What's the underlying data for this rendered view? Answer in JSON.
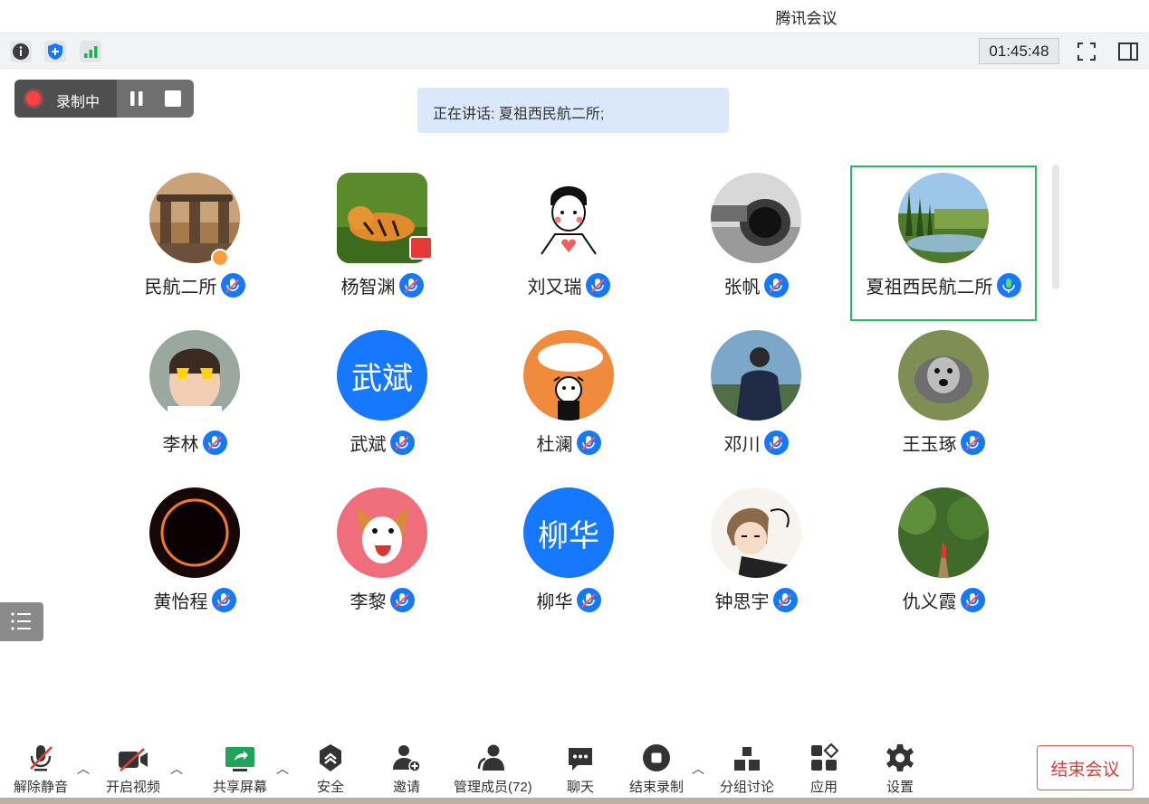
{
  "app": {
    "title": "腾讯会议"
  },
  "top_bar": {
    "timer": "01:45:48"
  },
  "recording": {
    "label": "录制中"
  },
  "speaking": {
    "text": "正在讲话: 夏祖西民航二所;"
  },
  "participants": [
    {
      "name": "民航二所",
      "avatar": "city-skyline-photo"
    },
    {
      "name": "杨智渊",
      "avatar": "tiger-photo"
    },
    {
      "name": "刘又瑞",
      "avatar": "cartoon-boy-illustration"
    },
    {
      "name": "张帆",
      "avatar": "jet-engine-photo"
    },
    {
      "name": "夏祖西民航二所",
      "avatar": "lake-trees-photo"
    },
    {
      "name": "李林",
      "avatar": "child-sunglasses-photo"
    },
    {
      "name": "武斌",
      "avatar_text": "武斌"
    },
    {
      "name": "杜澜",
      "avatar": "cow-cartoon-illustration"
    },
    {
      "name": "邓川",
      "avatar": "man-by-lake-photo"
    },
    {
      "name": "王玉琢",
      "avatar": "schnauzer-dog-photo"
    },
    {
      "name": "黄怡程",
      "avatar": "eclipse-ring-photo"
    },
    {
      "name": "李黎",
      "avatar": "corgi-cartoon-illustration"
    },
    {
      "name": "柳华",
      "avatar_text": "柳华"
    },
    {
      "name": "钟思宇",
      "avatar": "sleepy-girl-cartoon"
    },
    {
      "name": "仇义霞",
      "avatar": "forest-path-photo"
    }
  ],
  "toolbar": {
    "unmute": "解除静音",
    "start_video": "开启视频",
    "share_screen": "共享屏幕",
    "security": "安全",
    "invite": "邀请",
    "manage_members": "管理成员(72)",
    "chat": "聊天",
    "end_recording": "结束录制",
    "breakout": "分组讨论",
    "apps": "应用",
    "settings": "设置",
    "end_meeting": "结束会议"
  },
  "colors": {
    "accent": "#1677ff",
    "active_speaker": "#25b865",
    "danger": "#e53935",
    "speaking_bg": "#dbe8fb"
  }
}
